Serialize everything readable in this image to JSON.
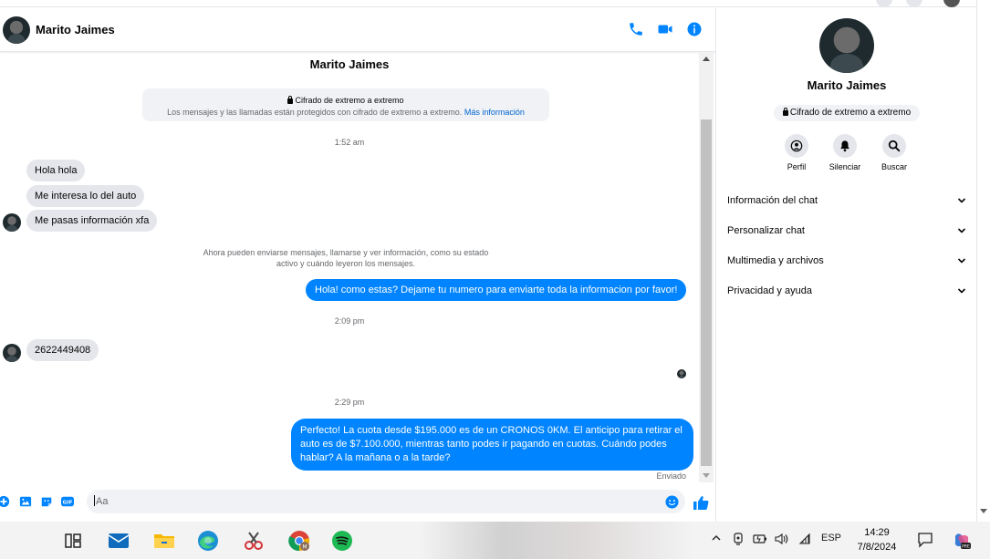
{
  "header": {
    "contact_name": "Marito Jaimes",
    "icons": [
      "phone-icon",
      "video-camera-icon",
      "info-icon"
    ]
  },
  "conversation": {
    "title": "Marito Jaimes",
    "e2e_title": "Cifrado de extremo a extremo",
    "e2e_desc": "Los mensajes y las llamadas están protegidos con cifrado de extremo a extremo.",
    "e2e_link": "Más información",
    "time1": "1:52 am",
    "in_msg_1": "Hola hola",
    "in_msg_2": "Me interesa lo del auto",
    "in_msg_3": "Me pasas información xfa",
    "system_note_1": "Ahora pueden enviarse mensajes, llamarse y ver información, como su estado",
    "system_note_2": "activo y cuándo leyeron los mensajes.",
    "out_msg_1": "Hola! como estas? Dejame tu numero para enviarte toda la informacion por favor!",
    "time2": "2:09 pm",
    "in_msg_4": "2622449408",
    "time3": "2:29 pm",
    "out_msg_2": "Perfecto! La cuota desde $195.000 es de un CRONOS 0KM. El anticipo para retirar el auto es de $7.100.000, mientras tanto podes ir pagando en cuotas. Cuándo podes hablar? A la mañana o a la tarde?",
    "sent_status": "Enviado"
  },
  "composer": {
    "placeholder": "Aa",
    "icons": [
      "plus-icon",
      "image-icon",
      "sticker-icon",
      "gif-icon",
      "emoji-icon",
      "like-icon"
    ]
  },
  "info_panel": {
    "name": "Marito Jaimes",
    "e2e_pill": "Cifrado de extremo a extremo",
    "actions": [
      {
        "label": "Perfil",
        "icon": "profile-icon"
      },
      {
        "label": "Silenciar",
        "icon": "bell-icon"
      },
      {
        "label": "Buscar",
        "icon": "search-icon"
      }
    ],
    "sections": [
      "Información del chat",
      "Personalizar chat",
      "Multimedia y archivos",
      "Privacidad y ayuda"
    ]
  },
  "taskbar": {
    "apps": [
      "task-view-icon",
      "mail-icon",
      "file-explorer-icon",
      "edge-icon",
      "snipping-tool-icon",
      "chrome-icon",
      "spotify-icon"
    ],
    "language": "ESP",
    "time": "14:29",
    "date": "7/8/2024"
  },
  "colors": {
    "accent": "#0084ff",
    "link": "#0064d1",
    "incoming_bubble": "#e4e6eb"
  }
}
